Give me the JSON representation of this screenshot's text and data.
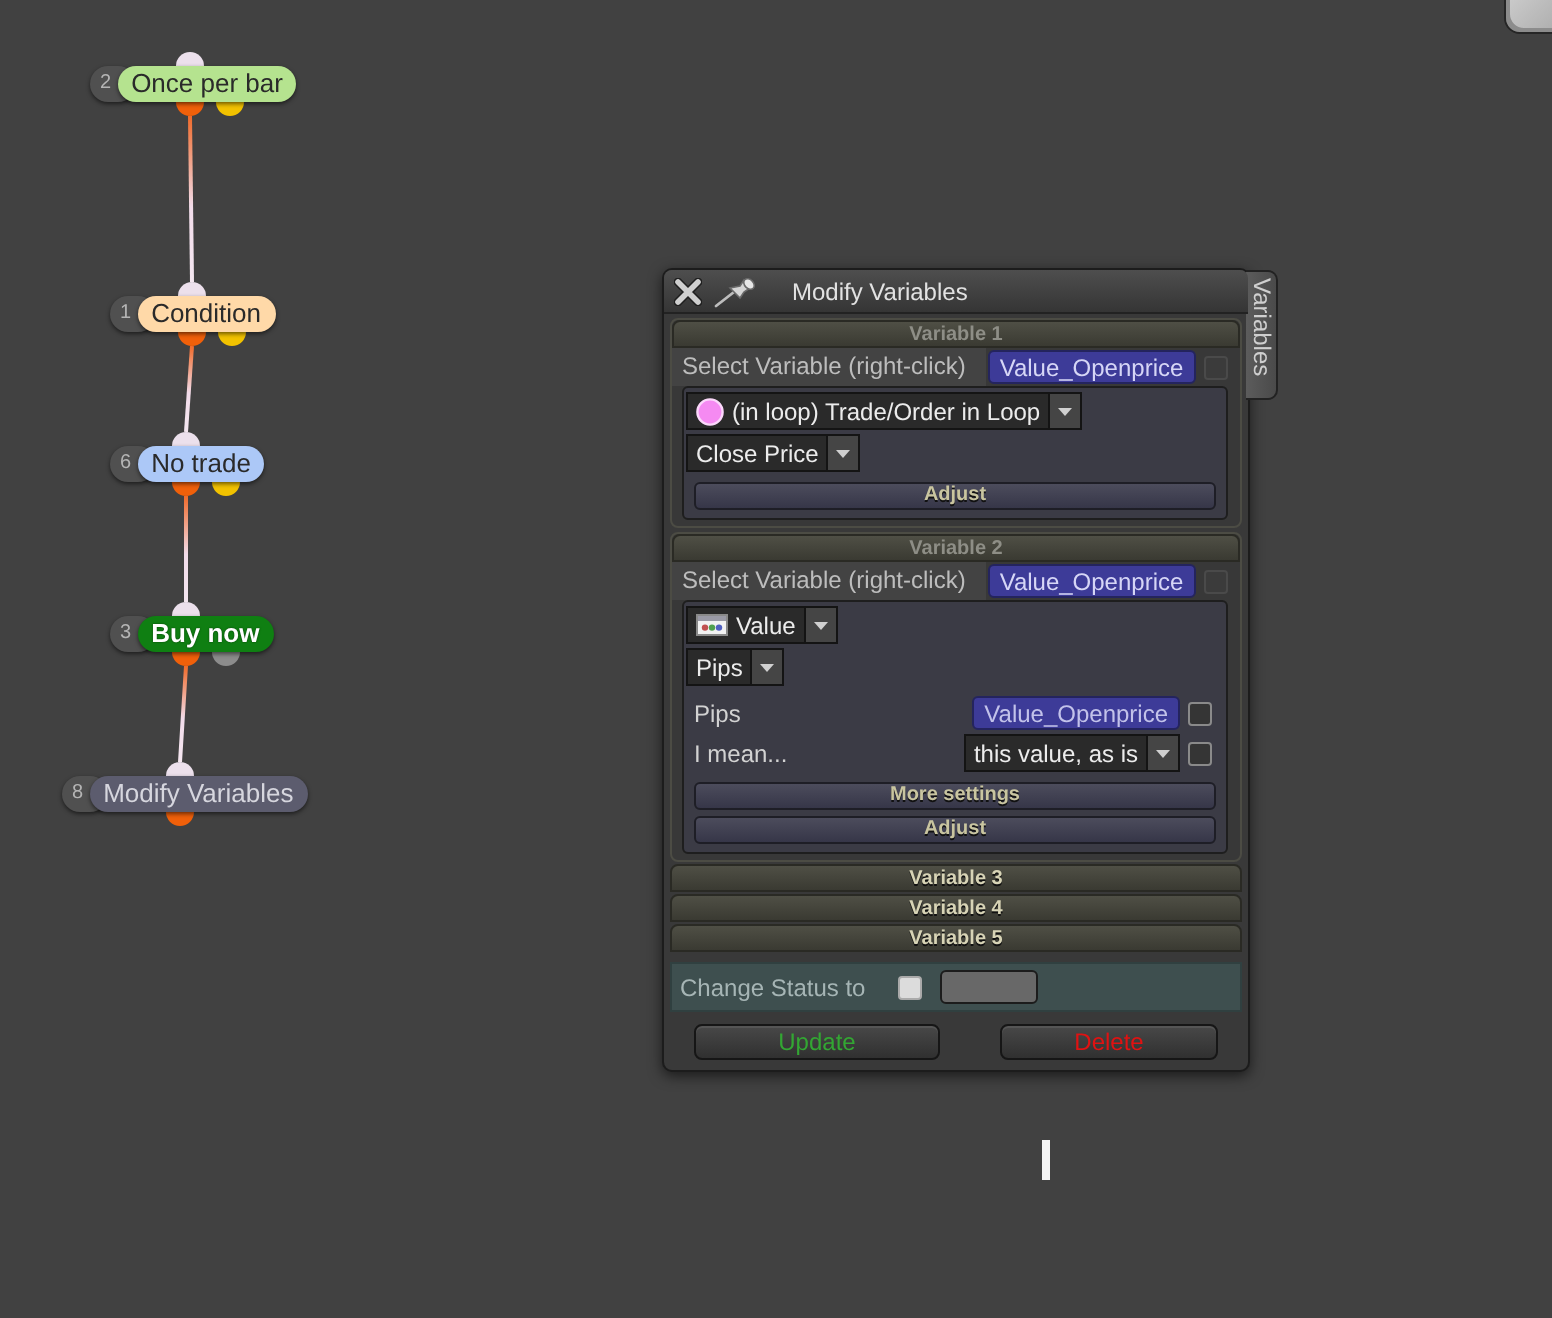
{
  "canvas": {
    "nodes": [
      {
        "number": "2",
        "label": "Once per bar",
        "kind": "condition",
        "color": "#b5e38f",
        "outputs": [
          {
            "color": "#f0600a"
          },
          {
            "color": "#f2c200"
          }
        ]
      },
      {
        "number": "1",
        "label": "Condition",
        "kind": "condition",
        "color": "#ffd9a8",
        "outputs": [
          {
            "color": "#f0600a"
          },
          {
            "color": "#f2c200"
          }
        ]
      },
      {
        "number": "6",
        "label": "No trade",
        "kind": "condition",
        "color": "#acc8f7",
        "outputs": [
          {
            "color": "#f0600a"
          },
          {
            "color": "#f2c200"
          }
        ]
      },
      {
        "number": "3",
        "label": "Buy now",
        "kind": "trade",
        "color": "#0f7f12",
        "outputs": [
          {
            "color": "#f0600a"
          },
          {
            "color": "#8c8c8c"
          }
        ]
      },
      {
        "number": "8",
        "label": "Modify Variables",
        "kind": "modifier",
        "color": "#5c5c6e",
        "outputs": [
          {
            "color": "#f0600a"
          }
        ]
      }
    ]
  },
  "dialog": {
    "title": "Modify Variables",
    "side_tab": "Variables",
    "sections": [
      {
        "header": "Variable 1",
        "expanded": true,
        "select_label": "Select Variable (right-click)",
        "variable": "Value_Openprice",
        "checked": false,
        "rows": [
          {
            "kind": "loop_dropdown",
            "value": "(in loop) Trade/Order in Loop"
          },
          {
            "kind": "dropdown",
            "value": "Close Price"
          },
          {
            "kind": "button",
            "label": "Adjust"
          }
        ]
      },
      {
        "header": "Variable 2",
        "expanded": true,
        "select_label": "Select Variable (right-click)",
        "variable": "Value_Openprice",
        "checked": false,
        "rows": [
          {
            "kind": "value_dropdown",
            "value": "Value"
          },
          {
            "kind": "dropdown",
            "value": "Pips"
          },
          {
            "kind": "variable_field",
            "label": "Pips",
            "value": "Value_Openprice",
            "checked": false
          },
          {
            "kind": "select_field",
            "label": "I mean...",
            "value": "this value, as is",
            "checked": false
          },
          {
            "kind": "button",
            "label": "More settings"
          },
          {
            "kind": "button",
            "label": "Adjust"
          }
        ]
      },
      {
        "header": "Variable 3",
        "expanded": false
      },
      {
        "header": "Variable 4",
        "expanded": false
      },
      {
        "header": "Variable 5",
        "expanded": false
      }
    ],
    "status": {
      "label": "Change Status to",
      "checked": false
    },
    "buttons": [
      {
        "label": "Update",
        "kind": "confirm"
      },
      {
        "label": "Delete",
        "kind": "danger"
      }
    ]
  }
}
